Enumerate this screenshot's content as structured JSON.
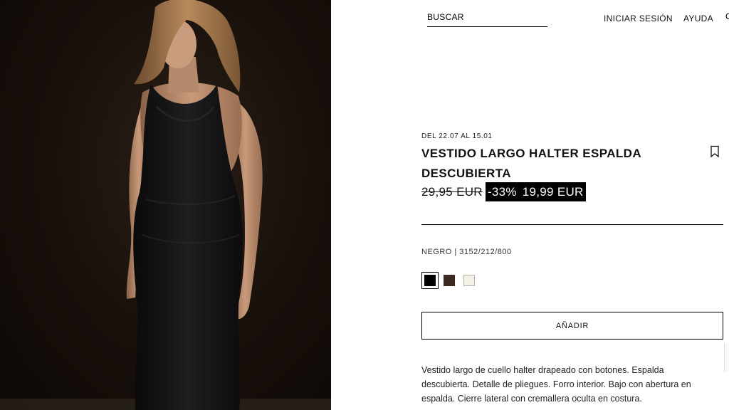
{
  "photo": {
    "alt_description": "",
    "icon": "product-photo"
  },
  "header": {
    "search_label": "BUSCAR",
    "login_label": "INICIAR SESIÓN",
    "help_label": "AYUDA",
    "extra_label": "C"
  },
  "product": {
    "dates": "DEL 22.07 AL 15.01",
    "title": "VESTIDO LARGO HALTER ESPALDA DESCUBIERTA",
    "old_price": "29,95 EUR",
    "discount": "-33%",
    "new_price": "19,99 EUR",
    "color_ref": "NEGRO | 3152/212/800",
    "swatches": [
      {
        "name": "black",
        "color": "#000000",
        "selected": true
      },
      {
        "name": "brown",
        "color": "#3b2a1f",
        "selected": false
      },
      {
        "name": "off-white",
        "color": "#f5f1e8",
        "selected": false
      }
    ],
    "add_label": "AÑADIR",
    "description": "Vestido largo de cuello halter drapeado con botones. Espalda descubierta. Detalle de pliegues. Forro interior. Bajo con abertura en espalda. Cierre lateral con cremallera oculta en costura."
  },
  "colors": {
    "accent": "#000000",
    "sale_bg": "#000000",
    "sale_text": "#ffffff"
  }
}
